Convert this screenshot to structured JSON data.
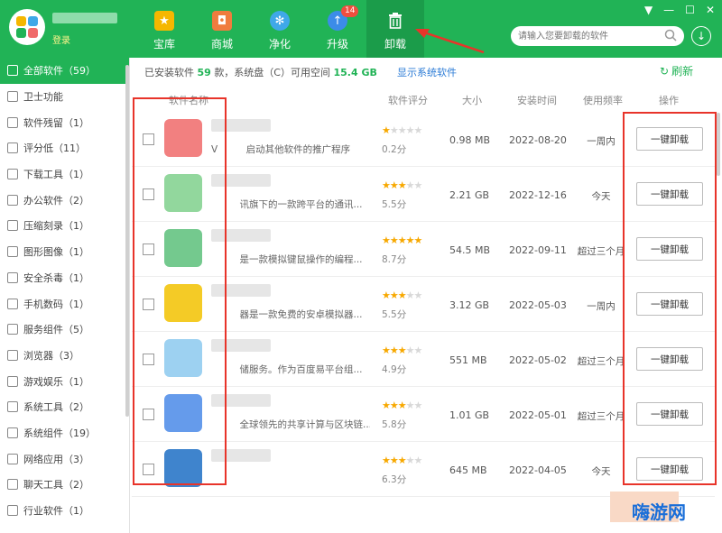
{
  "header": {
    "login_label": "登录",
    "nav": [
      {
        "label": "宝库",
        "icon": "star-icon",
        "color": "#f5b700"
      },
      {
        "label": "商城",
        "icon": "shopping-bag-icon",
        "color": "#f07c3e"
      },
      {
        "label": "净化",
        "icon": "fan-icon",
        "color": "#3fa8e8"
      },
      {
        "label": "升级",
        "icon": "upload-arrow-icon",
        "color": "#3c8ce8",
        "badge": "14"
      },
      {
        "label": "卸载",
        "icon": "trash-icon",
        "color": "#ffffff",
        "active": true
      }
    ],
    "search_placeholder": "请输入您要卸载的软件"
  },
  "sidebar": {
    "items": [
      {
        "label": "全部软件（59）",
        "active": true
      },
      {
        "label": "卫士功能"
      },
      {
        "label": "软件残留（1）"
      },
      {
        "label": "评分低（11）"
      },
      {
        "label": "下载工具（1）"
      },
      {
        "label": "办公软件（2）"
      },
      {
        "label": "压缩刻录（1）"
      },
      {
        "label": "图形图像（1）"
      },
      {
        "label": "安全杀毒（1）"
      },
      {
        "label": "手机数码（1）"
      },
      {
        "label": "服务组件（5）"
      },
      {
        "label": "浏览器（3）"
      },
      {
        "label": "游戏娱乐（1）"
      },
      {
        "label": "系统工具（2）"
      },
      {
        "label": "系统组件（19）"
      },
      {
        "label": "网络应用（3）"
      },
      {
        "label": "聊天工具（2）"
      },
      {
        "label": "行业软件（1）"
      }
    ]
  },
  "info": {
    "prefix": "已安装软件",
    "count": "59",
    "middle": "款，系统盘（C）可用空间",
    "free_space": "15.4 GB",
    "show_system": "显示系统软件",
    "refresh": "刷新"
  },
  "table": {
    "headers": {
      "name": "软件名称",
      "rating": "软件评分",
      "size": "大小",
      "install_time": "安装时间",
      "frequency": "使用频率",
      "action": "操作"
    },
    "rows": [
      {
        "desc": "V　　　启动其他软件的推广程序",
        "stars": 0.5,
        "score": "0.2分",
        "size": "0.98 MB",
        "date": "2022-08-20",
        "freq": "一周内",
        "action": "一键卸载",
        "icon_color": "#f06a6a"
      },
      {
        "desc": "　　　讯旗下的一款跨平台的通讯...",
        "stars": 2.5,
        "score": "5.5分",
        "size": "2.21 GB",
        "date": "2022-12-16",
        "freq": "今天",
        "action": "一键卸载",
        "icon_color": "#7fd08c"
      },
      {
        "desc": "　　　是一款模拟键鼠操作的编程...",
        "stars": 4.5,
        "score": "8.7分",
        "size": "54.5 MB",
        "date": "2022-09-11",
        "freq": "超过三个月",
        "action": "一键卸载",
        "icon_color": "#5cbf7a"
      },
      {
        "desc": "　　　器是一款免费的安卓模拟器...",
        "stars": 2.5,
        "score": "5.5分",
        "size": "3.12 GB",
        "date": "2022-05-03",
        "freq": "一周内",
        "action": "一键卸载",
        "icon_color": "#f2c200"
      },
      {
        "desc": "　　　储服务。作为百度易平台组...",
        "stars": 2.5,
        "score": "4.9分",
        "size": "551 MB",
        "date": "2022-05-02",
        "freq": "超过三个月",
        "action": "一键卸载",
        "icon_color": "#8cc9ee"
      },
      {
        "desc": "　　　全球领先的共享计算与区块链...",
        "stars": 2.5,
        "score": "5.8分",
        "size": "1.01 GB",
        "date": "2022-05-01",
        "freq": "超过三个月",
        "action": "一键卸载",
        "icon_color": "#4a8ae8"
      },
      {
        "desc": "　　　　　　　　　　　　",
        "stars": 2.5,
        "score": "6.3分",
        "size": "645 MB",
        "date": "2022-04-05",
        "freq": "今天",
        "action": "一键卸载",
        "icon_color": "#1d6fc4"
      }
    ]
  },
  "watermark": "嗨游网",
  "colors": {
    "brand": "#21b356",
    "accent_blue": "#2b7bd6",
    "annotation_red": "#e8342a",
    "star": "#f7a800"
  }
}
